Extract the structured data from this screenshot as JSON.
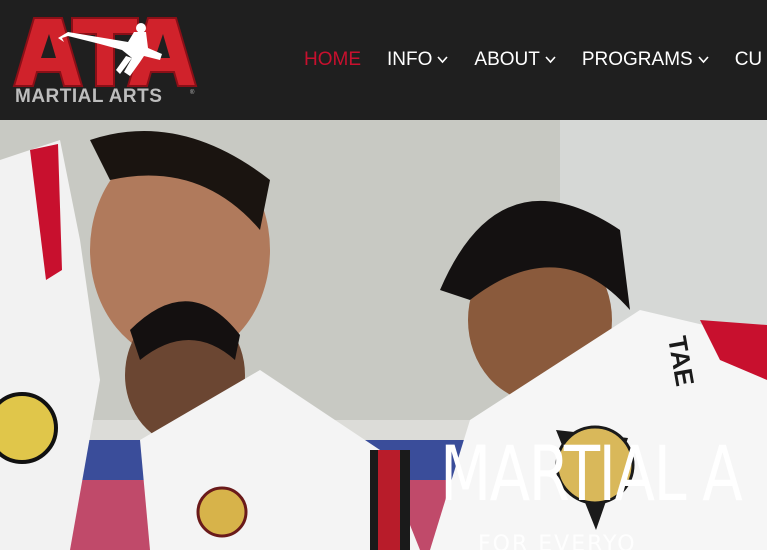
{
  "brand": {
    "logo_letters": "ATA",
    "logo_text": "MARTIAL ARTS",
    "logo_mark": "registered"
  },
  "nav": {
    "items": [
      {
        "label": "HOME",
        "active": true,
        "dropdown": false
      },
      {
        "label": "INFO",
        "active": false,
        "dropdown": true
      },
      {
        "label": "ABOUT",
        "active": false,
        "dropdown": true
      },
      {
        "label": "PROGRAMS",
        "active": false,
        "dropdown": true
      },
      {
        "label": "CU",
        "active": false,
        "dropdown": false
      }
    ]
  },
  "hero": {
    "title": "MARTIAL A",
    "subtitle": "FOR EVERYO",
    "patch_text": "TAE"
  },
  "colors": {
    "header_bg": "#1f1f1f",
    "accent_red": "#c8102e",
    "nav_text": "#ffffff",
    "logo_gray": "#bdbdbd"
  }
}
